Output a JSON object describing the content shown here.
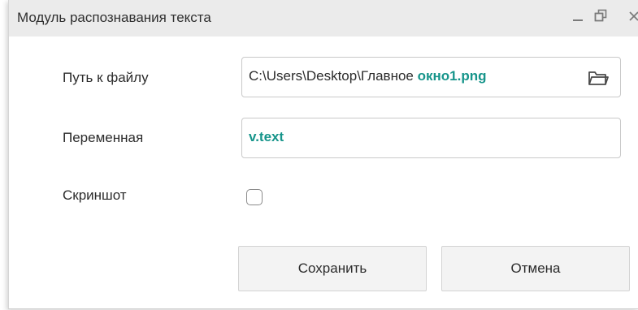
{
  "window": {
    "title": "Модуль распознавания текста",
    "controls": {
      "minimize": "_",
      "restore": "🗗",
      "close": "✕"
    }
  },
  "form": {
    "file_path": {
      "label": "Путь к файлу",
      "value_plain": "C:\\Users\\Desktop\\Главное ",
      "value_accent": "окно1.png",
      "icon": "folder-icon"
    },
    "variable": {
      "label": "Переменная",
      "value": "v.text"
    },
    "screenshot": {
      "label": "Скриншот",
      "checked": false
    }
  },
  "buttons": {
    "save": "Сохранить",
    "cancel": "Отмена"
  },
  "colors": {
    "accent": "#17958b",
    "titlebar": "#ebebeb"
  }
}
